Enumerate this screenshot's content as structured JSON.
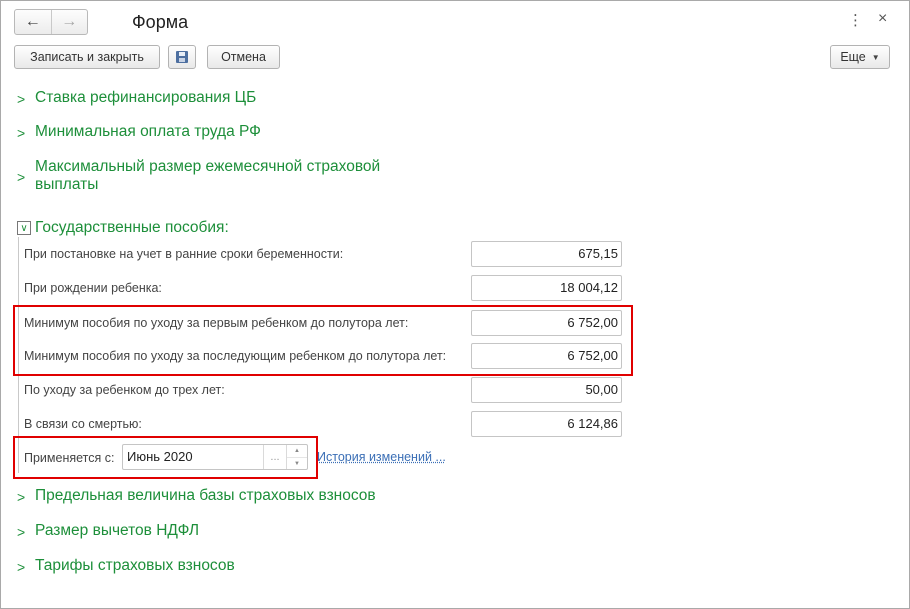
{
  "window": {
    "title": "Форма",
    "nav": {
      "back_icon": "←",
      "forward_icon": "→"
    },
    "kebab_icon": "⋮",
    "close_icon": "×"
  },
  "toolbar": {
    "save_close_label": "Записать и закрыть",
    "cancel_label": "Отмена",
    "more_label": "Еще",
    "more_caret": "▼"
  },
  "groups": {
    "refinancing_rate": "Ставка рефинансирования ЦБ",
    "minimum_wage": "Минимальная оплата труда РФ",
    "max_insurance_1": "Максимальный размер ежемесячной страховой",
    "max_insurance_2": "выплаты",
    "state_benefits": "Государственные пособия:",
    "contrib_base": "Предельная величина базы страховых взносов",
    "ndfl_deductions": "Размер вычетов НДФЛ",
    "contrib_rates": "Тарифы страховых взносов"
  },
  "chevrons": {
    "collapsed": ">",
    "expanded": "∨"
  },
  "benefits": {
    "early_pregnancy": {
      "label": "При постановке на учет в ранние сроки беременности:",
      "value": "675,15"
    },
    "birth": {
      "label": "При рождении ребенка:",
      "value": "18 004,12"
    },
    "min_first_child": {
      "label": "Минимум пособия по уходу за первым ребенком до полутора лет:",
      "value": "6 752,00"
    },
    "min_next_child": {
      "label": "Минимум пособия по уходу за последующим ребенком до полутора лет:",
      "value": "6 752,00"
    },
    "care_three_years": {
      "label": "По уходу за ребенком до трех лет:",
      "value": "50,00"
    },
    "death": {
      "label": "В связи со смертью:",
      "value": "6 124,86"
    }
  },
  "applies": {
    "label": "Применяется с:",
    "value": "Июнь 2020",
    "dots": "...",
    "spin_up": "▲",
    "spin_down": "▼",
    "history_link": "История изменений ..."
  }
}
